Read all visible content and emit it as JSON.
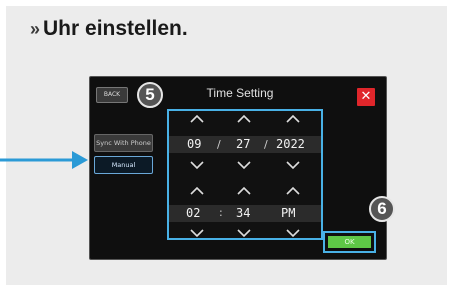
{
  "heading": {
    "marker": "»",
    "text": "Uhr einstellen."
  },
  "screen": {
    "back_label": "BACK",
    "title": "Time Setting",
    "sync_label": "Sync With Phone",
    "manual_label": "Manual",
    "ok_label": "OK"
  },
  "callouts": {
    "five": "5",
    "six": "6"
  },
  "date": {
    "month": "09",
    "day": "27",
    "year": "2022",
    "sep1": "/",
    "sep2": "/"
  },
  "time": {
    "hour": "02",
    "minute": "34",
    "ampm": "PM",
    "sep": ":"
  },
  "colors": {
    "highlight": "#49b1e6",
    "close": "#e0262b",
    "ok": "#5ec746",
    "arrow": "#2b9ad6"
  }
}
